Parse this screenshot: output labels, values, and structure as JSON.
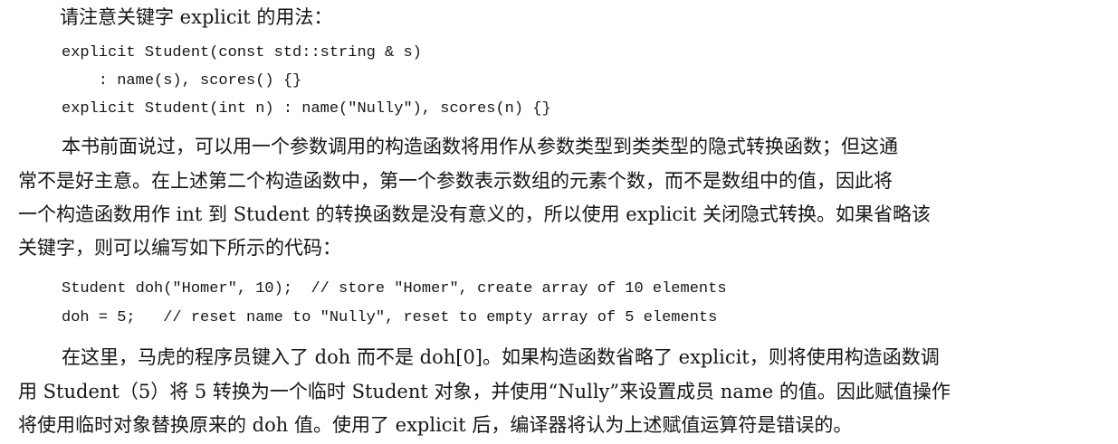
{
  "heading": "请注意关键字 explicit 的用法：",
  "code_block_1": [
    "explicit Student(const std::string & s)",
    "    : name(s), scores() {}",
    "explicit Student(int n) : name(\"Nully\"), scores(n) {}"
  ],
  "paragraph_1": [
    "本书前面说过，可以用一个参数调用的构造函数将用作从参数类型到类类型的隐式转换函数；但这通",
    "常不是好主意。在上述第二个构造函数中，第一个参数表示数组的元素个数，而不是数组中的值，因此将",
    "一个构造函数用作 int 到 Student 的转换函数是没有意义的，所以使用 explicit 关闭隐式转换。如果省略该",
    "关键字，则可以编写如下所示的代码："
  ],
  "code_block_2": [
    "Student doh(\"Homer\", 10);  // store \"Homer\", create array of 10 elements",
    "doh = 5;   // reset name to \"Nully\", reset to empty array of 5 elements"
  ],
  "paragraph_2": [
    "在这里，马虎的程序员键入了 doh 而不是 doh[0]。如果构造函数省略了 explicit，则将使用构造函数调",
    "用 Student（5）将 5 转换为一个临时 Student 对象，并使用“Nully”来设置成员 name 的值。因此赋值操作",
    "将使用临时对象替换原来的 doh 值。使用了 explicit 后，编译器将认为上述赋值运算符是错误的。"
  ]
}
